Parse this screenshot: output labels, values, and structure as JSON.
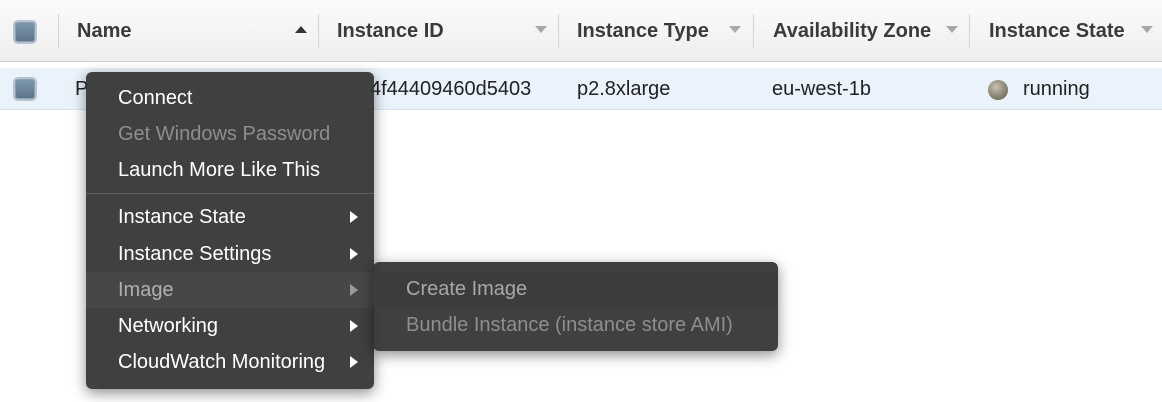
{
  "table": {
    "columns": [
      {
        "label": "Name",
        "sort": "ascending"
      },
      {
        "label": "Instance ID",
        "sort": "none"
      },
      {
        "label": "Instance Type",
        "sort": "none"
      },
      {
        "label": "Availability Zone",
        "sort": "none"
      },
      {
        "label": "Instance State",
        "sort": "none"
      }
    ],
    "rows": [
      {
        "name": "P",
        "instance_id": "4f44409460d5403",
        "instance_type": "p2.8xlarge",
        "availability_zone": "eu-west-1b",
        "instance_state": "running"
      }
    ]
  },
  "context_menu": {
    "items": [
      {
        "label": "Connect",
        "enabled": true,
        "submenu": false
      },
      {
        "label": "Get Windows Password",
        "enabled": false,
        "submenu": false
      },
      {
        "label": "Launch More Like This",
        "enabled": true,
        "submenu": false
      },
      {
        "label": "Instance State",
        "enabled": true,
        "submenu": true
      },
      {
        "label": "Instance Settings",
        "enabled": true,
        "submenu": true
      },
      {
        "label": "Image",
        "enabled": true,
        "submenu": true,
        "active": true
      },
      {
        "label": "Networking",
        "enabled": true,
        "submenu": true
      },
      {
        "label": "CloudWatch Monitoring",
        "enabled": true,
        "submenu": true
      }
    ],
    "image_submenu": [
      {
        "label": "Create Image",
        "highlighted": true
      },
      {
        "label": "Bundle Instance (instance store AMI)",
        "highlighted": false
      }
    ]
  },
  "colors": {
    "header_bg": "#eeeeee",
    "selected_row_bg": "#eaf3fb",
    "menu_bg": "#323232",
    "checkbox": "#6b8399",
    "status_running": "#8b8473"
  }
}
